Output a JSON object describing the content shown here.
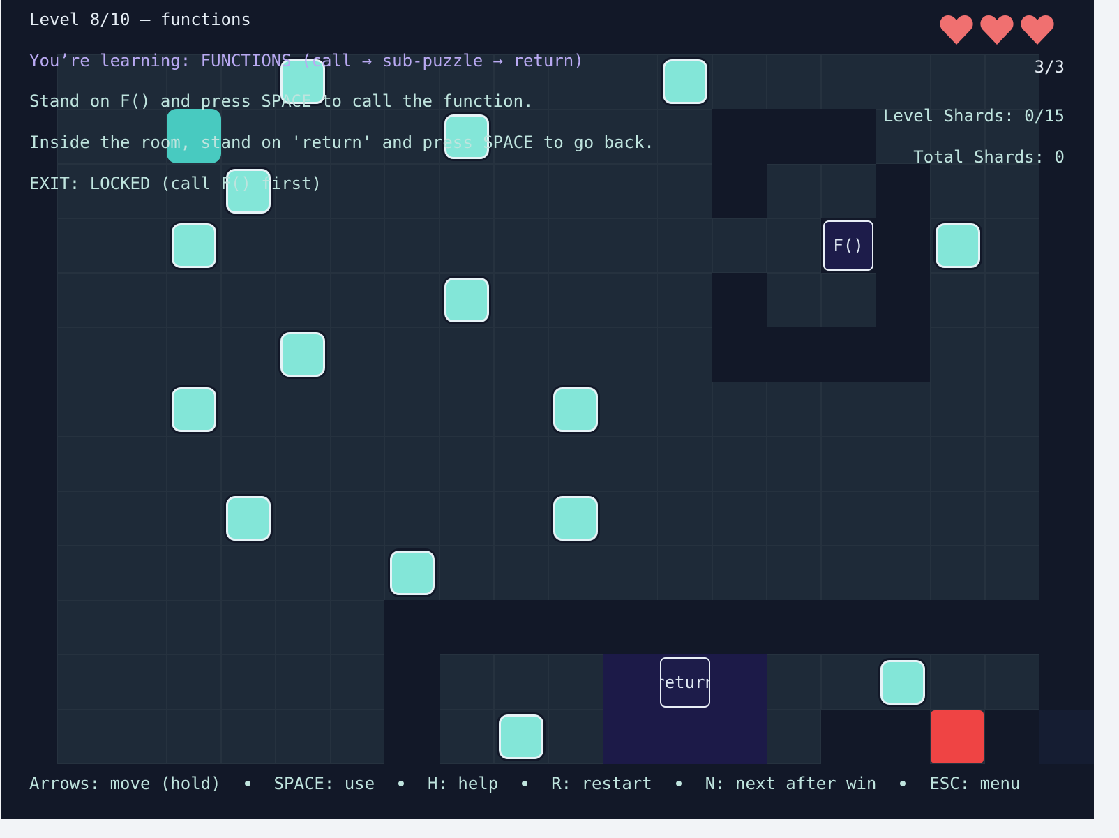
{
  "hud": {
    "title": "Level 8/10 – functions",
    "learning": "You’re learning: FUNCTIONS (call → sub-puzzle → return)",
    "instruction_call": "Stand on F() and press SPACE to call the function.",
    "instruction_return": "Inside the room, stand on 'return' and press SPACE to go back.",
    "exit_status": "EXIT: LOCKED (call F() first)",
    "lives_count": "3/3",
    "level_shards": "Level Shards: 0/15",
    "total_shards": "Total Shards: 0",
    "lives": 3
  },
  "board": {
    "cols": 20,
    "rows": 15,
    "wall_cells": [
      [
        13,
        2
      ],
      [
        14,
        2
      ],
      [
        15,
        2
      ],
      [
        13,
        3
      ],
      [
        16,
        3
      ],
      [
        15,
        4
      ],
      [
        16,
        4
      ],
      [
        13,
        5
      ],
      [
        16,
        5
      ],
      [
        13,
        6
      ],
      [
        14,
        6
      ],
      [
        15,
        6
      ],
      [
        16,
        6
      ],
      [
        7,
        11
      ],
      [
        8,
        11
      ],
      [
        9,
        11
      ],
      [
        10,
        11
      ],
      [
        11,
        11
      ],
      [
        12,
        11
      ],
      [
        13,
        11
      ],
      [
        14,
        11
      ],
      [
        15,
        11
      ],
      [
        16,
        11
      ],
      [
        17,
        11
      ],
      [
        18,
        11
      ],
      [
        7,
        12
      ],
      [
        7,
        13
      ],
      [
        15,
        13
      ],
      [
        16,
        13
      ],
      [
        18,
        13
      ]
    ],
    "room_cells": [
      [
        11,
        12
      ],
      [
        12,
        12
      ],
      [
        13,
        12
      ],
      [
        11,
        13
      ],
      [
        12,
        13
      ],
      [
        13,
        13
      ]
    ],
    "floor_light_cells": [
      [
        19,
        13
      ]
    ],
    "shards": [
      [
        5,
        1
      ],
      [
        12,
        1
      ],
      [
        8,
        2
      ],
      [
        4,
        3
      ],
      [
        3,
        4
      ],
      [
        17,
        4
      ],
      [
        8,
        5
      ],
      [
        5,
        6
      ],
      [
        3,
        7
      ],
      [
        10,
        7
      ],
      [
        4,
        9
      ],
      [
        10,
        9
      ],
      [
        7,
        10
      ],
      [
        16,
        12
      ],
      [
        9,
        13
      ]
    ],
    "player": [
      3,
      2
    ],
    "function_door": [
      15,
      4
    ],
    "return_door": [
      12,
      12
    ],
    "exit": [
      17,
      13
    ]
  },
  "labels": {
    "function_door": "F()",
    "return_door": "return"
  },
  "footer": {
    "move": "Arrows: move (hold)",
    "use": "SPACE: use",
    "help": "H: help",
    "restart": "R: restart",
    "next": "N: next after win",
    "menu": "ESC: menu"
  },
  "colors": {
    "floor": "#1e2a38",
    "wall": "#121828",
    "room": "#1c1a48",
    "shard": "#83e6d8",
    "player": "#48cac0",
    "exit": "#ef4444",
    "heart": "#f07070"
  }
}
